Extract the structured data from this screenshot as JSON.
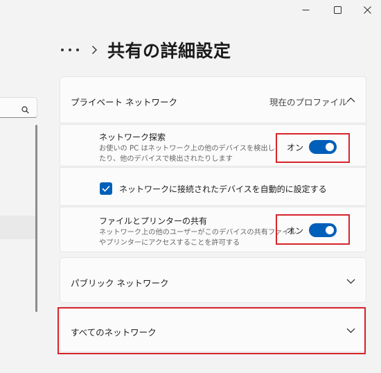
{
  "window": {
    "minimize_icon": "minimize-icon",
    "maximize_icon": "maximize-icon",
    "close_icon": "close-icon"
  },
  "sidebar": {
    "search_icon": "search-icon"
  },
  "header": {
    "more_icon": "more-icon",
    "chevron_icon": "chevron-right-icon",
    "title": "共有の詳細設定"
  },
  "private_network": {
    "label": "プライベート ネットワーク",
    "profile_status": "現在のプロファイル",
    "expanded": true,
    "network_discovery": {
      "title": "ネットワーク探索",
      "description_line1": "お使いの PC はネットワーク上の他のデバイスを検出し",
      "description_line2": "たり、他のデバイスで検出されたりします",
      "toggle_label": "オン",
      "enabled": true
    },
    "auto_setup": {
      "label": "ネットワークに接続されたデバイスを自動的に設定する",
      "checked": true
    },
    "file_printer_sharing": {
      "title": "ファイルとプリンターの共有",
      "description_line1": "ネットワーク上の他のユーザーがこのデバイスの共有ファイル",
      "description_line2": "やプリンターにアクセスすることを許可する",
      "toggle_label": "オン",
      "enabled": true
    }
  },
  "public_network": {
    "label": "パブリック ネットワーク",
    "expanded": false
  },
  "all_networks": {
    "label": "すべてのネットワーク",
    "expanded": false
  },
  "colors": {
    "accent": "#005fb8",
    "highlight": "#d6232b"
  }
}
